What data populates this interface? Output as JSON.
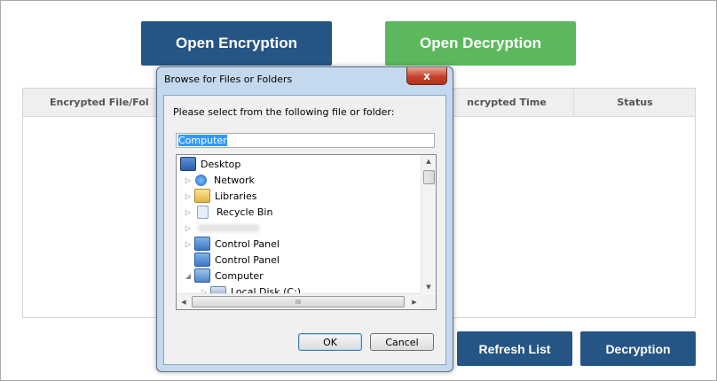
{
  "main": {
    "open_encryption_label": "Open Encryption",
    "open_decryption_label": "Open Decryption",
    "refresh_label": "Refresh List",
    "decryption_label": "Decryption",
    "table": {
      "columns": [
        "Encrypted File/Fol",
        "ncrypted Time",
        "Status"
      ]
    }
  },
  "dialog": {
    "title": "Browse for Files or Folders",
    "close_symbol": "x",
    "prompt": "Please select from the following file or folder:",
    "path_value": "Computer",
    "tree": [
      {
        "label": "Desktop",
        "icon": "desktop-icon"
      },
      {
        "label": "Network",
        "icon": "network-icon"
      },
      {
        "label": "Libraries",
        "icon": "libraries-icon"
      },
      {
        "label": "Recycle Bin",
        "icon": "recycle-bin-icon"
      },
      {
        "label": "",
        "icon": "user-folder-icon"
      },
      {
        "label": "Control Panel",
        "icon": "control-panel-icon"
      },
      {
        "label": "Control Panel",
        "icon": "control-panel-icon"
      },
      {
        "label": "Computer",
        "icon": "computer-icon"
      },
      {
        "label": "Local Disk (C:)",
        "icon": "local-disk-icon"
      }
    ],
    "hscroll_grip": "III",
    "ok_label": "OK",
    "cancel_label": "Cancel"
  },
  "colors": {
    "primary_button": "#255584",
    "success_button": "#5cb85c"
  }
}
